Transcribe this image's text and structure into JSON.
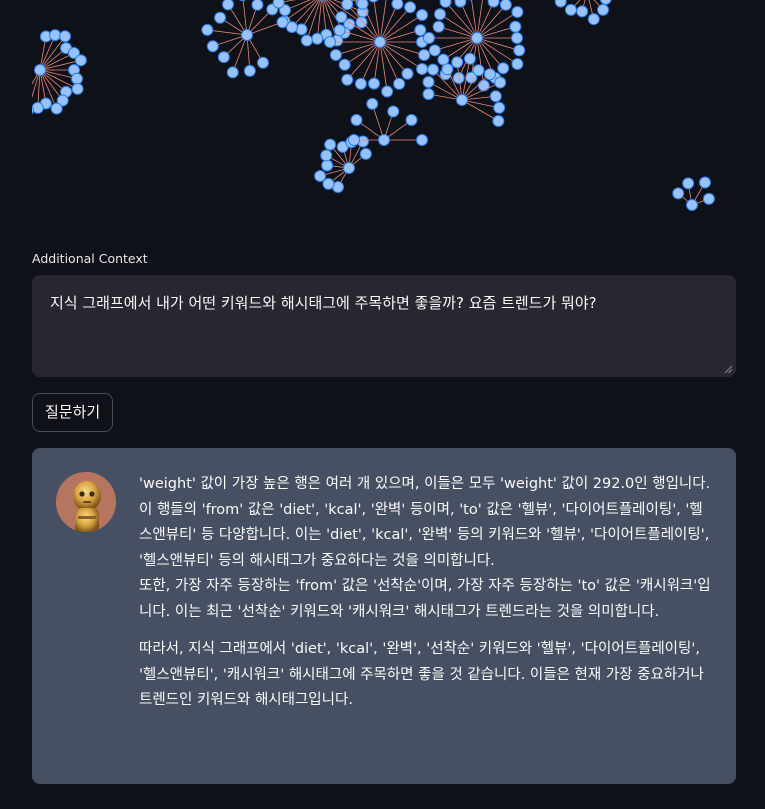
{
  "context": {
    "label": "Additional Context",
    "value": "지식 그래프에서 내가 어떤 키워드와 해시태그에 주목하면 좋을까? 요즘 트렌드가 뭐야?"
  },
  "ask_button": {
    "label": "질문하기"
  },
  "answer": {
    "paragraph_1_line_1": "'weight' 값이 가장 높은 행은 여러 개 있으며, 이들은 모두 'weight' 값이 292.0인 행입니다. 이 행들의 'from' 값은 'diet', 'kcal', '완벽' 등이며, 'to' 값은 '헬뷰', '다이어트플레이팅', '헬스앤뷰티' 등 다양합니다. 이는 'diet', 'kcal', '완벽' 등의 키워드와 '헬뷰', '다이어트플레이팅', '헬스앤뷰티' 등의 해시태그가 중요하다는 것을 의미합니다.",
    "paragraph_1_line_2": "또한, 가장 자주 등장하는 'from' 값은 '선착순'이며, 가장 자주 등장하는 'to' 값은 '캐시워크'입니다. 이는 최근 '선착순' 키워드와 '캐시워크' 해시태그가 트렌드라는 것을 의미합니다.",
    "paragraph_2": "따라서, 지식 그래프에서 'diet', 'kcal', '완벽', '선착순' 키워드와 '헬뷰', '다이어트플레이팅', '헬스앤뷰티', '캐시워크' 해시태그에 주목하면 좋을 것 같습니다. 이들은 현재 가장 중요하거나 트렌드인 키워드와 해시태그입니다."
  },
  "colors": {
    "background": "#0e1117",
    "node_fill": "#97c2fc",
    "node_stroke": "#2b7ce9",
    "edge": "#e8897a",
    "input_bg": "#262730",
    "card_bg": "#475063"
  }
}
